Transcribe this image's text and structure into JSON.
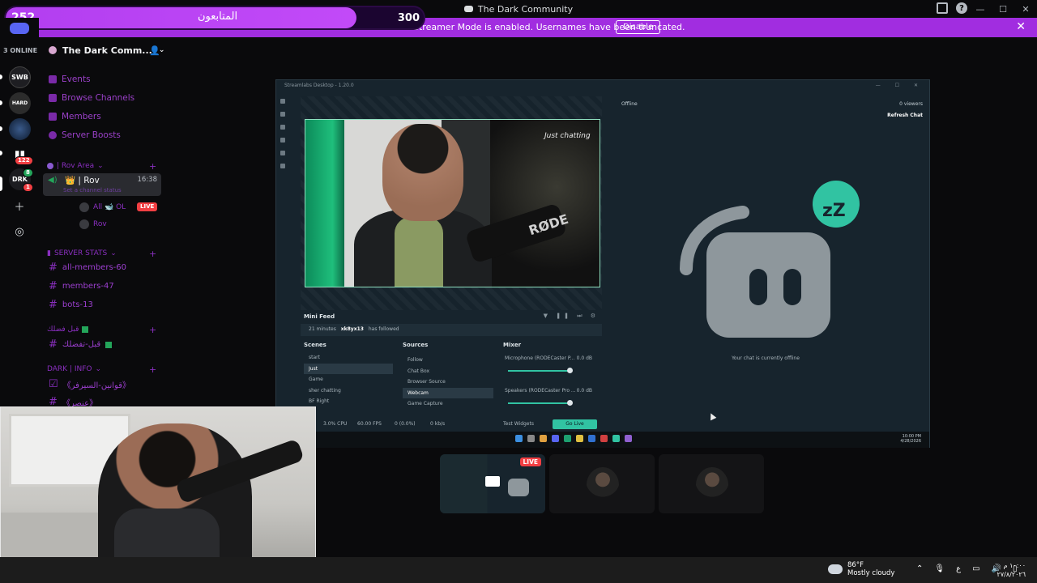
{
  "window": {
    "title": "The Dark Community"
  },
  "goal_overlay": {
    "current": "252",
    "label": "المتابعون",
    "target": "300",
    "progress_fraction": 0.84
  },
  "banner": {
    "message": "Streamer Mode is enabled. Usernames have been truncated.",
    "button": "Disable"
  },
  "rail": {
    "online_count": "3 ONLINE",
    "servers": [
      {
        "name": "SWB-server-icon",
        "label": "SWB"
      },
      {
        "name": "HARD-server-icon",
        "label": "HARD"
      },
      {
        "name": "dark-server-icon",
        "label": ""
      },
      {
        "name": "chart-server-icon",
        "label": ""
      },
      {
        "name": "DRK-server-icon",
        "label": "DRK"
      }
    ],
    "badge_122": "122",
    "badge_8": "8",
    "badge_1": "1"
  },
  "sidebar": {
    "server_name": "The Dark Comm...",
    "nav": [
      "Events",
      "Browse Channels",
      "Members",
      "Server Boosts"
    ],
    "categories": {
      "rov_area": "| Rov Area",
      "server_stats": "SERVER STATS",
      "arabic": "قبل فضلك",
      "dark_info": "DARK | INFO"
    },
    "voice_channel": {
      "name": "👑 | Rov",
      "timer": "16:38",
      "status": "Set a channel status",
      "users": [
        {
          "name": "All 🐋 OL",
          "live": "LIVE"
        },
        {
          "name": "Rov"
        }
      ]
    },
    "stat_channels": [
      "all-members-60",
      "members-47",
      "bots-13"
    ],
    "arabic_channel": "قبل-تفضلك",
    "info_channels": [
      "《قوانين-السيرفر》",
      "《عنصر》"
    ]
  },
  "streamlabs": {
    "title": "Streamlabs Desktop - 1.20.0",
    "mini_feed": {
      "title": "Mini Feed",
      "event_time": "21 minutes",
      "event_user": "xk8yx13",
      "event_action": "has followed"
    },
    "scenes_label": "Scenes",
    "scenes": [
      "start",
      "Just",
      "Game",
      "sher chatting",
      "BF Right"
    ],
    "sources_label": "Sources",
    "sources": [
      "Follow",
      "Chat Box",
      "Browser Source",
      "Webcam",
      "Game Capture"
    ],
    "mixer_label": "Mixer",
    "mixer": [
      {
        "name": "Microphone (RODECaster P...",
        "db": "0.0 dB"
      },
      {
        "name": "Speakers (RODECaster Pro ...",
        "db": "0.0 dB"
      }
    ],
    "status": {
      "cpu": "3.0% CPU",
      "fps": "60.00 FPS",
      "dropped": "0 (0.0%)",
      "bandwidth": "0 kb/s",
      "test_widgets": "Test Widgets"
    },
    "go_live": "Go Live",
    "chat": {
      "status": "Offline",
      "viewers": "0 viewers",
      "refresh": "Refresh Chat",
      "offline_message": "Your chat is currently offline"
    },
    "camera_brand": "RØDE",
    "camera_sign": "Just chatting",
    "tray_time": "10:00 PM",
    "tray_date": "4/28/2026"
  },
  "tiles": {
    "live": "LIVE"
  },
  "taskbar": {
    "temp": "86°F",
    "weather": "Mostly cloudy",
    "time": "١٠:٠٠ م",
    "date": "٢٧/٨/٢٠٢٦"
  },
  "colors": {
    "accent_purple": "#a12de0",
    "live_red": "#f23f43",
    "streamlabs_green": "#31c3a2"
  }
}
